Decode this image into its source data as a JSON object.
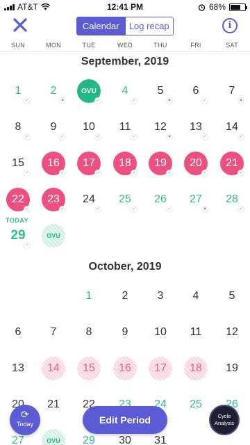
{
  "status_bar": {
    "carrier": "AT&T",
    "time": "12:41 PM",
    "battery": "68%",
    "battery_level": 0.68
  },
  "header": {
    "close_icon": "close-x-icon",
    "tabs": [
      {
        "label": "Calendar",
        "active": true
      },
      {
        "label": "Log recap",
        "active": false
      }
    ],
    "info_label": "i"
  },
  "weekdays": [
    "SUN",
    "MON",
    "TUE",
    "WED",
    "THU",
    "FRI",
    "SAT"
  ],
  "colors": {
    "accent": "#5b5bd6",
    "period": "#ee4f7e",
    "fertile": "#2dbf8c",
    "ovulation": "#21b886",
    "dark_button": "#1e1f33"
  },
  "months": [
    {
      "title": "September, 2019",
      "days": [
        {
          "label": "1",
          "style": "green",
          "mark": "check"
        },
        {
          "label": "2",
          "style": "green",
          "mark": "heart"
        },
        {
          "label": "OVU",
          "style": "ovu",
          "mark": "check"
        },
        {
          "label": "4",
          "style": "green",
          "mark": "check"
        },
        {
          "label": "5",
          "style": "plain",
          "mark": "heart"
        },
        {
          "label": "6",
          "style": "plain",
          "mark": "check"
        },
        {
          "label": "7",
          "style": "plain",
          "mark": "heart"
        },
        {
          "label": "8",
          "style": "plain",
          "mark": "check"
        },
        {
          "label": "9",
          "style": "plain",
          "mark": "check"
        },
        {
          "label": "10",
          "style": "plain",
          "mark": "check"
        },
        {
          "label": "11",
          "style": "plain",
          "mark": "check"
        },
        {
          "label": "12",
          "style": "plain",
          "mark": "heart"
        },
        {
          "label": "13",
          "style": "plain",
          "mark": "check"
        },
        {
          "label": "14",
          "style": "plain",
          "mark": "check"
        },
        {
          "label": "15",
          "style": "plain",
          "mark": "check"
        },
        {
          "label": "16",
          "style": "period",
          "mark": "check"
        },
        {
          "label": "17",
          "style": "period",
          "mark": "check"
        },
        {
          "label": "18",
          "style": "period",
          "mark": "check"
        },
        {
          "label": "19",
          "style": "period",
          "mark": "check"
        },
        {
          "label": "20",
          "style": "period",
          "mark": "check"
        },
        {
          "label": "21",
          "style": "period",
          "mark": "check"
        },
        {
          "label": "22",
          "style": "period",
          "mark": "check"
        },
        {
          "label": "23",
          "style": "period",
          "mark": "check"
        },
        {
          "label": "24",
          "style": "plain",
          "mark": "check"
        },
        {
          "label": "25",
          "style": "green",
          "mark": "check"
        },
        {
          "label": "26",
          "style": "green",
          "mark": "check"
        },
        {
          "label": "27",
          "style": "green",
          "mark": "heart"
        },
        {
          "label": "28",
          "style": "green",
          "mark": "check"
        },
        {
          "label": "29",
          "style": "today",
          "mark": "check"
        },
        {
          "label": "OVU",
          "style": "ovu-pred",
          "mark": ""
        }
      ]
    },
    {
      "title": "October, 2019",
      "days": [
        {
          "label": "1",
          "style": "green",
          "mark": ""
        },
        {
          "label": "2",
          "style": "plain",
          "mark": ""
        },
        {
          "label": "3",
          "style": "plain",
          "mark": ""
        },
        {
          "label": "4",
          "style": "plain",
          "mark": ""
        },
        {
          "label": "5",
          "style": "plain",
          "mark": ""
        },
        {
          "label": "6",
          "style": "plain",
          "mark": ""
        },
        {
          "label": "7",
          "style": "plain",
          "mark": ""
        },
        {
          "label": "8",
          "style": "plain",
          "mark": ""
        },
        {
          "label": "9",
          "style": "plain",
          "mark": ""
        },
        {
          "label": "10",
          "style": "plain",
          "mark": ""
        },
        {
          "label": "11",
          "style": "plain",
          "mark": ""
        },
        {
          "label": "12",
          "style": "plain",
          "mark": ""
        },
        {
          "label": "13",
          "style": "plain",
          "mark": ""
        },
        {
          "label": "14",
          "style": "predicted",
          "mark": ""
        },
        {
          "label": "15",
          "style": "predicted",
          "mark": ""
        },
        {
          "label": "16",
          "style": "predicted",
          "mark": ""
        },
        {
          "label": "17",
          "style": "predicted",
          "mark": ""
        },
        {
          "label": "18",
          "style": "predicted",
          "mark": ""
        },
        {
          "label": "19",
          "style": "plain",
          "mark": ""
        },
        {
          "label": "20",
          "style": "plain",
          "mark": ""
        },
        {
          "label": "21",
          "style": "plain",
          "mark": ""
        },
        {
          "label": "22",
          "style": "plain",
          "mark": ""
        },
        {
          "label": "23",
          "style": "green",
          "mark": ""
        },
        {
          "label": "24",
          "style": "green",
          "mark": ""
        },
        {
          "label": "25",
          "style": "green",
          "mark": ""
        },
        {
          "label": "26",
          "style": "green",
          "mark": ""
        },
        {
          "label": "27",
          "style": "green",
          "mark": ""
        },
        {
          "label": "OVU",
          "style": "ovu-pred",
          "mark": ""
        },
        {
          "label": "29",
          "style": "green",
          "mark": ""
        },
        {
          "label": "30",
          "style": "plain",
          "mark": ""
        },
        {
          "label": "31",
          "style": "plain",
          "mark": ""
        }
      ]
    }
  ],
  "today_label": "TODAY",
  "buttons": {
    "today": "Today",
    "today_icon": "refresh-icon",
    "edit_period": "Edit Period",
    "cycle_analysis": "Cycle Analysis"
  }
}
